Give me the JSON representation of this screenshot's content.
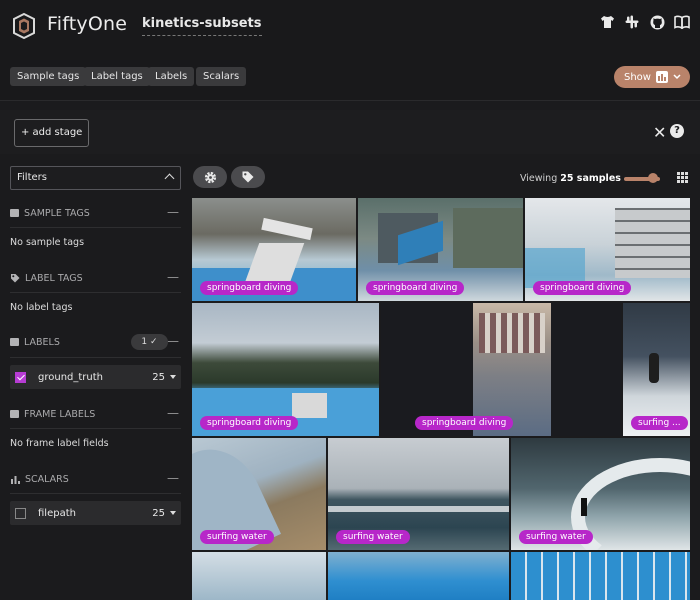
{
  "header": {
    "app_title": "FiftyOne",
    "dataset_name": "kinetics-subsets",
    "icons": [
      "t-shirt-icon",
      "slack-icon",
      "github-icon",
      "book-icon"
    ],
    "tag_buttons": [
      "Sample tags",
      "Label tags",
      "Labels",
      "Scalars"
    ],
    "show_label": "Show",
    "accent": "#b9836a"
  },
  "stages": {
    "add_stage_label": "+ add stage",
    "close_glyph": "✕",
    "help_glyph": "?"
  },
  "sidebar": {
    "filters_label": "Filters",
    "sample_tags": {
      "title": "SAMPLE TAGS",
      "empty": "No sample tags"
    },
    "label_tags": {
      "title": "LABEL TAGS",
      "empty": "No label tags"
    },
    "labels": {
      "title": "LABELS",
      "badge": "1 ✓",
      "fields": [
        {
          "name": "ground_truth",
          "count": "25",
          "checked": true
        }
      ]
    },
    "frame_labels": {
      "title": "FRAME LABELS",
      "empty": "No frame label fields"
    },
    "scalars": {
      "title": "SCALARS",
      "fields": [
        {
          "name": "filepath",
          "count": "25",
          "checked": false
        }
      ]
    }
  },
  "grid": {
    "viewing_prefix": "Viewing ",
    "viewing_count": "25 samples",
    "label_color": "#b727c9",
    "tiles": [
      {
        "label": "springboard diving"
      },
      {
        "label": "springboard diving"
      },
      {
        "label": "springboard diving"
      },
      {
        "label": "springboard diving"
      },
      {
        "label": "springboard diving"
      },
      {
        "label": "surfing ..."
      },
      {
        "label": "surfing water"
      },
      {
        "label": "surfing water"
      },
      {
        "label": "surfing water"
      }
    ]
  }
}
